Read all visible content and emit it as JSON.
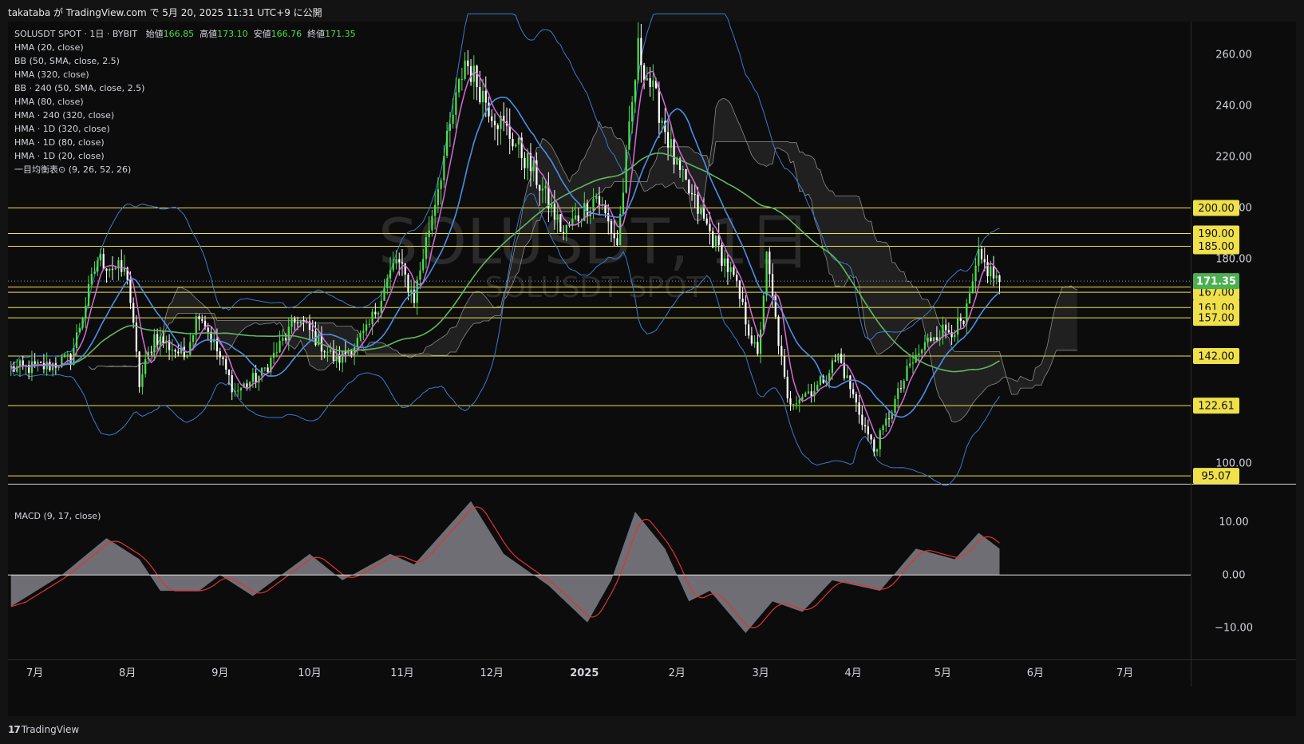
{
  "header": {
    "published_text": "takataba が TradingView.com で 5月 20, 2025 11:31 UTC+9 に公開"
  },
  "watermark": {
    "main": "SOLUSDT, 1日",
    "sub": "SOLUSDT SPOT"
  },
  "legend": {
    "symbol": "SOLUSDT SPOT · 1日 · BYBIT",
    "open_label": "始値",
    "open": "166.85",
    "high_label": "高値",
    "high": "173.10",
    "low_label": "安値",
    "low": "166.76",
    "close_label": "終値",
    "close": "171.35",
    "indicators": [
      "HMA (20, close)",
      "BB (50, SMA, close, 2.5)",
      "HMA (320, close)",
      "BB · 240 (50, SMA, close, 2.5)",
      "HMA (80, close)",
      "HMA · 240 (320, close)",
      "HMA · 1D (320, close)",
      "HMA · 1D (80, close)",
      "HMA · 1D (20, close)",
      "一目均衡表⊙ (9, 26, 52, 26)"
    ]
  },
  "macd_legend": "MACD (9, 17, close)",
  "footer": {
    "logo_mark": "17",
    "logo_text": "TradingView"
  },
  "colors": {
    "up": "#4cdf4c",
    "down": "#ffffff",
    "hma20": "#d36bd6",
    "hma80": "#4b8fe8",
    "hma320": "#5fb85f",
    "bb": "#3c79cf",
    "level": "#f0e04a",
    "macd_hist": "#6e6e74",
    "signal": "#e03434",
    "last_price": "#4caf50"
  },
  "chart_data": {
    "type": "candlestick",
    "price_axis": {
      "ylim": [
        92,
        273
      ],
      "ticks": [
        100,
        120,
        140,
        160,
        180,
        200,
        220,
        240,
        260
      ],
      "tick_labels": [
        "100.00",
        "",
        "",
        "",
        "180.00",
        "200.00",
        "220.00",
        "240.00",
        "260.00"
      ]
    },
    "time_axis": {
      "labels": [
        "7月",
        "8月",
        "9月",
        "10月",
        "11月",
        "12月",
        "2025",
        "2月",
        "3月",
        "4月",
        "5月",
        "6月",
        "7月"
      ],
      "dates": [
        "2024-07-01",
        "2024-08-01",
        "2024-09-01",
        "2024-10-01",
        "2024-11-01",
        "2024-12-01",
        "2025-01-01",
        "2025-02-01",
        "2025-03-01",
        "2025-04-01",
        "2025-05-01",
        "2025-06-01",
        "2025-07-01"
      ]
    },
    "horizontal_levels": [
      "200.00",
      "190.00",
      "185.00",
      "169.00",
      "167.00",
      "161.00",
      "157.00",
      "142.00",
      "122.61",
      "95.07"
    ],
    "last_price": "171.35",
    "price_path": [
      [
        "2024-06-23",
        137
      ],
      [
        "2024-07-05",
        138
      ],
      [
        "2024-07-13",
        141
      ],
      [
        "2024-07-22",
        180
      ],
      [
        "2024-08-01",
        174
      ],
      [
        "2024-08-05",
        131
      ],
      [
        "2024-08-10",
        150
      ],
      [
        "2024-08-20",
        142
      ],
      [
        "2024-08-25",
        160
      ],
      [
        "2024-09-06",
        128
      ],
      [
        "2024-09-15",
        135
      ],
      [
        "2024-09-27",
        157
      ],
      [
        "2024-10-10",
        140
      ],
      [
        "2024-10-20",
        151
      ],
      [
        "2024-10-30",
        180
      ],
      [
        "2024-11-05",
        165
      ],
      [
        "2024-11-15",
        220
      ],
      [
        "2024-11-22",
        258
      ],
      [
        "2024-12-01",
        238
      ],
      [
        "2024-12-08",
        227
      ],
      [
        "2024-12-15",
        214
      ],
      [
        "2024-12-25",
        190
      ],
      [
        "2025-01-05",
        205
      ],
      [
        "2025-01-12",
        186
      ],
      [
        "2025-01-19",
        262
      ],
      [
        "2025-01-27",
        235
      ],
      [
        "2025-02-01",
        215
      ],
      [
        "2025-02-10",
        195
      ],
      [
        "2025-02-20",
        172
      ],
      [
        "2025-02-28",
        141
      ],
      [
        "2025-03-03",
        180
      ],
      [
        "2025-03-10",
        124
      ],
      [
        "2025-03-20",
        130
      ],
      [
        "2025-03-27",
        142
      ],
      [
        "2025-04-03",
        120
      ],
      [
        "2025-04-08",
        105
      ],
      [
        "2025-04-20",
        138
      ],
      [
        "2025-04-28",
        151
      ],
      [
        "2025-05-08",
        154
      ],
      [
        "2025-05-13",
        180
      ],
      [
        "2025-05-20",
        171
      ]
    ],
    "macd_axis": {
      "ylim": [
        -16,
        17
      ],
      "ticks": [
        10,
        0,
        -10
      ],
      "tick_labels": [
        "10.00",
        "0.00",
        "−10.00"
      ]
    },
    "macd_path": [
      [
        "2024-06-23",
        -6
      ],
      [
        "2024-07-10",
        0
      ],
      [
        "2024-07-25",
        7
      ],
      [
        "2024-08-05",
        3
      ],
      [
        "2024-08-12",
        -3
      ],
      [
        "2024-08-25",
        -3
      ],
      [
        "2024-09-01",
        0
      ],
      [
        "2024-09-12",
        -4
      ],
      [
        "2024-10-01",
        4
      ],
      [
        "2024-10-12",
        -1
      ],
      [
        "2024-10-28",
        4
      ],
      [
        "2024-11-05",
        2
      ],
      [
        "2024-11-24",
        14
      ],
      [
        "2024-12-05",
        4
      ],
      [
        "2024-12-20",
        -2
      ],
      [
        "2025-01-02",
        -9
      ],
      [
        "2025-01-10",
        -1
      ],
      [
        "2025-01-18",
        12
      ],
      [
        "2025-01-28",
        5
      ],
      [
        "2025-02-05",
        -5
      ],
      [
        "2025-02-12",
        -3
      ],
      [
        "2025-02-24",
        -11
      ],
      [
        "2025-03-05",
        -5
      ],
      [
        "2025-03-15",
        -7
      ],
      [
        "2025-03-25",
        -1
      ],
      [
        "2025-04-10",
        -3
      ],
      [
        "2025-04-22",
        5
      ],
      [
        "2025-05-05",
        3
      ],
      [
        "2025-05-13",
        8
      ],
      [
        "2025-05-20",
        5
      ]
    ],
    "title": "SOLUSDT, 1日"
  }
}
